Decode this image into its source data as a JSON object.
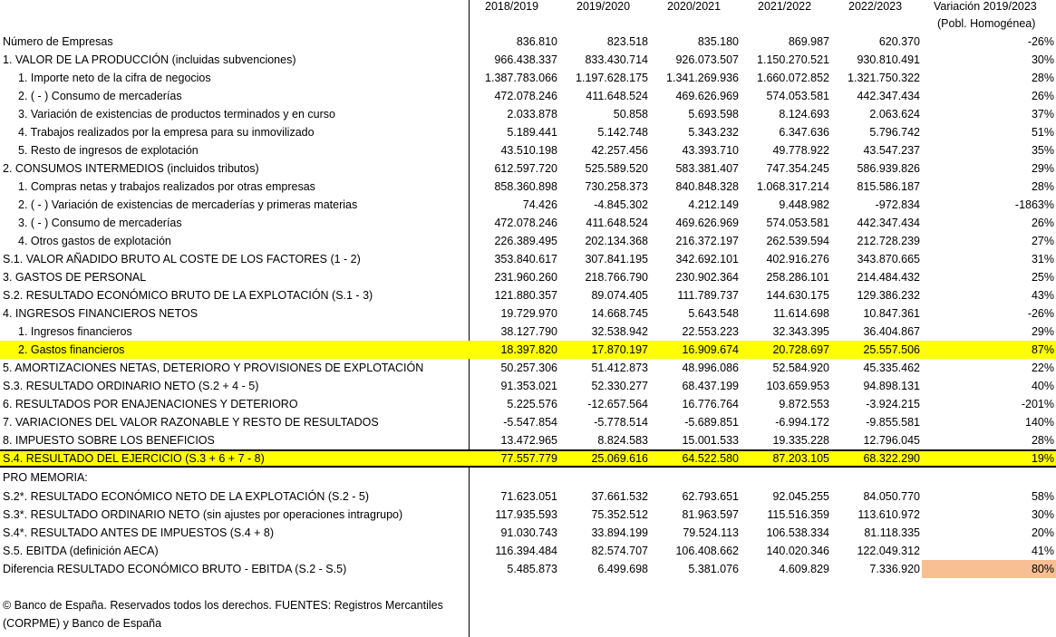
{
  "header": {
    "years": [
      "2018/2019",
      "2019/2020",
      "2020/2021",
      "2021/2022",
      "2022/2023"
    ],
    "variation_line1": "Variación 2019/2023",
    "variation_line2": "(Pobl. Homogénea)"
  },
  "rows": [
    {
      "label": "Número de Empresas",
      "values": [
        "836.810",
        "823.518",
        "835.180",
        "869.987",
        "620.370"
      ],
      "variation": "-26%"
    },
    {
      "label": "1. VALOR DE LA PRODUCCIÓN (incluidas subvenciones)",
      "values": [
        "966.438.337",
        "833.430.714",
        "926.073.507",
        "1.150.270.521",
        "930.810.491"
      ],
      "variation": "30%"
    },
    {
      "label": "1. Importe neto de la cifra de negocios",
      "values": [
        "1.387.783.066",
        "1.197.628.175",
        "1.341.269.936",
        "1.660.072.852",
        "1.321.750.322"
      ],
      "variation": "28%"
    },
    {
      "label": "2. ( - ) Consumo de mercaderías",
      "values": [
        "472.078.246",
        "411.648.524",
        "469.626.969",
        "574.053.581",
        "442.347.434"
      ],
      "variation": "26%"
    },
    {
      "label": "3. Variación de existencias de productos terminados y en curso",
      "values": [
        "2.033.878",
        "50.858",
        "5.693.598",
        "8.124.693",
        "2.063.624"
      ],
      "variation": "37%"
    },
    {
      "label": "4. Trabajos realizados por la empresa para su inmovilizado",
      "values": [
        "5.189.441",
        "5.142.748",
        "5.343.232",
        "6.347.636",
        "5.796.742"
      ],
      "variation": "51%"
    },
    {
      "label": "5. Resto de ingresos de explotación",
      "values": [
        "43.510.198",
        "42.257.456",
        "43.393.710",
        "49.778.922",
        "43.547.237"
      ],
      "variation": "35%"
    },
    {
      "label": "2. CONSUMOS INTERMEDIOS (incluidos tributos)",
      "values": [
        "612.597.720",
        "525.589.520",
        "583.381.407",
        "747.354.245",
        "586.939.826"
      ],
      "variation": "29%"
    },
    {
      "label": "1. Compras netas y trabajos realizados por otras empresas",
      "values": [
        "858.360.898",
        "730.258.373",
        "840.848.328",
        "1.068.317.214",
        "815.586.187"
      ],
      "variation": "28%"
    },
    {
      "label": "2. ( - ) Variación de existencias de mercaderías y primeras materias",
      "values": [
        "74.426",
        "-4.845.302",
        "4.212.149",
        "9.448.982",
        "-972.834"
      ],
      "variation": "-1863%"
    },
    {
      "label": "3. ( - ) Consumo de mercaderías",
      "values": [
        "472.078.246",
        "411.648.524",
        "469.626.969",
        "574.053.581",
        "442.347.434"
      ],
      "variation": "26%"
    },
    {
      "label": "4. Otros gastos de explotación",
      "values": [
        "226.389.495",
        "202.134.368",
        "216.372.197",
        "262.539.594",
        "212.728.239"
      ],
      "variation": "27%"
    },
    {
      "label": "S.1. VALOR AÑADIDO BRUTO AL COSTE DE LOS FACTORES (1 - 2)",
      "values": [
        "353.840.617",
        "307.841.195",
        "342.692.101",
        "402.916.276",
        "343.870.665"
      ],
      "variation": "31%"
    },
    {
      "label": "3. GASTOS DE PERSONAL",
      "values": [
        "231.960.260",
        "218.766.790",
        "230.902.364",
        "258.286.101",
        "214.484.432"
      ],
      "variation": "25%"
    },
    {
      "label": "S.2. RESULTADO ECONÓMICO BRUTO DE LA EXPLOTACIÓN (S.1 - 3)",
      "values": [
        "121.880.357",
        "89.074.405",
        "111.789.737",
        "144.630.175",
        "129.386.232"
      ],
      "variation": "43%"
    },
    {
      "label": "4. INGRESOS FINANCIEROS NETOS",
      "values": [
        "19.729.970",
        "14.668.745",
        "5.643.548",
        "11.614.698",
        "10.847.361"
      ],
      "variation": "-26%"
    },
    {
      "label": "1. Ingresos financieros",
      "values": [
        "38.127.790",
        "32.538.942",
        "22.553.223",
        "32.343.395",
        "36.404.867"
      ],
      "variation": "29%"
    },
    {
      "label": "2. Gastos financieros",
      "values": [
        "18.397.820",
        "17.870.197",
        "16.909.674",
        "20.728.697",
        "25.557.506"
      ],
      "variation": "87%"
    },
    {
      "label": "5. AMORTIZACIONES NETAS, DETERIORO Y PROVISIONES DE EXPLOTACIÓN",
      "values": [
        "50.257.306",
        "51.412.873",
        "48.996.086",
        "52.584.920",
        "45.335.462"
      ],
      "variation": "22%"
    },
    {
      "label": "S.3.  RESULTADO ORDINARIO NETO (S.2 + 4 - 5)",
      "values": [
        "91.353.021",
        "52.330.277",
        "68.437.199",
        "103.659.953",
        "94.898.131"
      ],
      "variation": "40%"
    },
    {
      "label": "6. RESULTADOS POR ENAJENACIONES Y DETERIORO",
      "values": [
        "5.225.576",
        "-12.657.564",
        "16.776.764",
        "9.872.553",
        "-3.924.215"
      ],
      "variation": "-201%"
    },
    {
      "label": "7. VARIACIONES DEL VALOR RAZONABLE Y RESTO DE RESULTADOS",
      "values": [
        "-5.547.854",
        "-5.778.514",
        "-5.689.851",
        "-6.994.172",
        "-9.855.581"
      ],
      "variation": "140%"
    },
    {
      "label": "8. IMPUESTO SOBRE LOS BENEFICIOS",
      "values": [
        "13.472.965",
        "8.824.583",
        "15.001.533",
        "19.335.228",
        "12.796.045"
      ],
      "variation": "28%"
    },
    {
      "label": "S.4. RESULTADO DEL EJERCICIO (S.3 + 6 + 7 - 8)",
      "values": [
        "77.557.779",
        "25.069.616",
        "64.522.580",
        "87.203.105",
        "68.322.290"
      ],
      "variation": "19%"
    }
  ],
  "memo_title": "PRO MEMORIA:",
  "memo_rows": [
    {
      "label": "S.2*. RESULTADO ECONÓMICO NETO DE LA EXPLOTACIÓN (S.2 - 5)",
      "values": [
        "71.623.051",
        "37.661.532",
        "62.793.651",
        "92.045.255",
        "84.050.770"
      ],
      "variation": "58%"
    },
    {
      "label": "S.3*.  RESULTADO ORDINARIO NETO (sin ajustes por operaciones intragrupo)",
      "values": [
        "117.935.593",
        "75.352.512",
        "81.963.597",
        "115.516.359",
        "113.610.972"
      ],
      "variation": "30%"
    },
    {
      "label": "S.4*. RESULTADO ANTES DE IMPUESTOS (S.4 + 8)",
      "values": [
        "91.030.743",
        "33.894.199",
        "79.524.113",
        "106.538.334",
        "81.118.335"
      ],
      "variation": "20%"
    },
    {
      "label": "S.5. EBITDA (definición AECA)",
      "values": [
        "116.394.484",
        "82.574.707",
        "106.408.662",
        "140.020.346",
        "122.049.312"
      ],
      "variation": "41%"
    },
    {
      "label": "Diferencia RESULTADO ECONÓMICO BRUTO - EBITDA (S.2 - S.5)",
      "values": [
        "5.485.873",
        "6.499.698",
        "5.381.076",
        "4.609.829",
        "7.336.920"
      ],
      "variation": "80%"
    }
  ],
  "footnote": "© Banco de España. Reservados todos los derechos. FUENTES: Registros Mercantiles (CORPME) y Banco de España",
  "colors": {
    "highlight_yellow": "#ffff00",
    "highlight_orange": "#f8bf93",
    "grid_line": "#000000"
  }
}
